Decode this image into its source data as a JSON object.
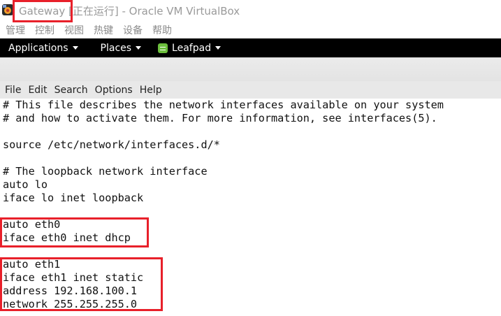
{
  "window": {
    "title": "Gateway [正在运行] - Oracle VM VirtualBox",
    "icon": "virtualbox-icon"
  },
  "vbox_menu": {
    "items": [
      "管理",
      "控制",
      "视图",
      "热键",
      "设备",
      "帮助"
    ]
  },
  "gnome_panel": {
    "applications": "Applications",
    "places": "Places",
    "app_name": "Leafpad",
    "app_icon": "leafpad-icon"
  },
  "leafpad_menu": {
    "items": [
      "File",
      "Edit",
      "Search",
      "Options",
      "Help"
    ]
  },
  "editor": {
    "lines": [
      "# This file describes the network interfaces available on your system",
      "# and how to activate them. For more information, see interfaces(5).",
      "",
      "source /etc/network/interfaces.d/*",
      "",
      "# The loopback network interface",
      "auto lo",
      "iface lo inet loopback",
      "",
      "auto eth0",
      "iface eth0 inet dhcp",
      "",
      "auto eth1",
      "iface eth1 inet static",
      "address 192.168.100.1",
      "network 255.255.255.0"
    ]
  },
  "colors": {
    "annotation": "#e8202a",
    "panel": "#000000",
    "leafpad_icon": "#6cbf3d"
  }
}
